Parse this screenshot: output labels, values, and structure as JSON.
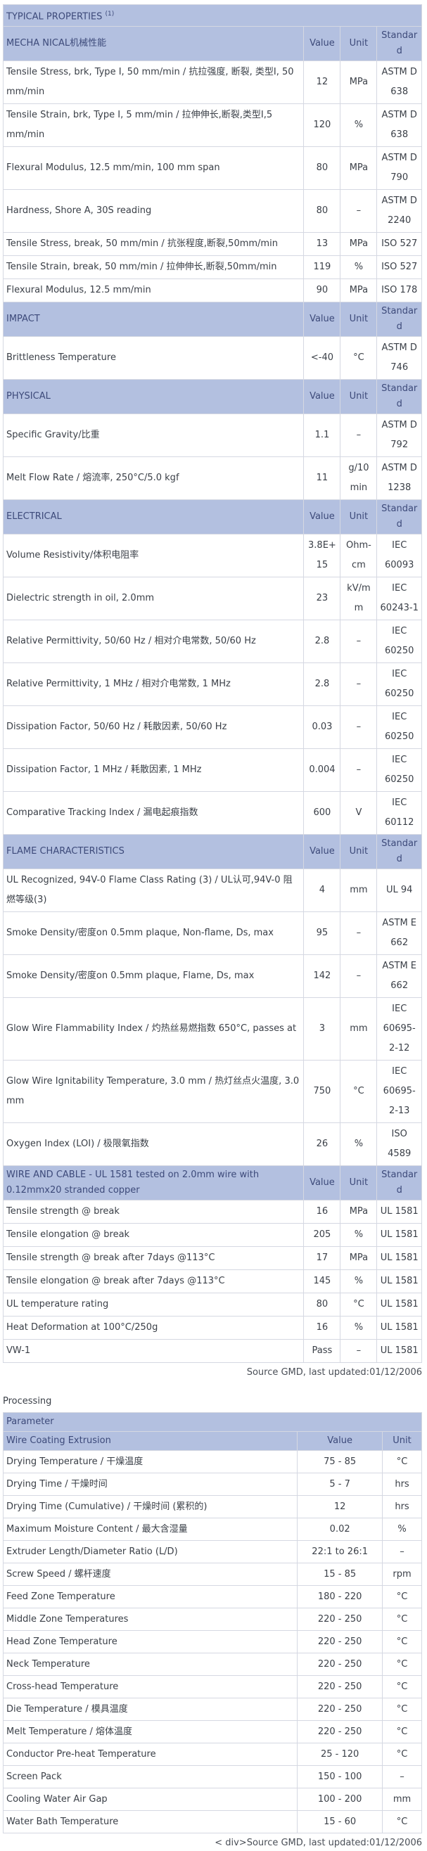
{
  "properties": {
    "sections": [
      {
        "title": "TYPICAL PROPERTIES",
        "title_note": "(1)",
        "header": {
          "label": "MECHA NICAL机械性能",
          "value": "Value",
          "unit": "Unit",
          "standard": "Standard"
        },
        "rows": [
          {
            "label": "Tensile Stress, brk, Type I, 50 mm/min / 抗拉强度, 断裂, 类型I, 50 mm/min",
            "value": "12",
            "unit": "MPa",
            "standard": "ASTM D 638"
          },
          {
            "label": "Tensile Strain, brk, Type I, 5 mm/min / 拉伸伸长,断裂,类型I,5 mm/min",
            "value": "120",
            "unit": "%",
            "standard": "ASTM D 638"
          },
          {
            "label": "Flexural Modulus, 12.5 mm/min, 100 mm span",
            "value": "80",
            "unit": "MPa",
            "standard": "ASTM D 790"
          },
          {
            "label": "Hardness, Shore A, 30S reading",
            "value": "80",
            "unit": "–",
            "standard": "ASTM D 2240"
          },
          {
            "label": "Tensile Stress, break, 50 mm/min / 抗张程度,断裂,50mm/min",
            "value": "13",
            "unit": "MPa",
            "standard": "ISO 527"
          },
          {
            "label": "Tensile Strain, break, 50 mm/min / 拉伸伸长,断裂,50mm/min",
            "value": "119",
            "unit": "%",
            "standard": "ISO 527"
          },
          {
            "label": "Flexural Modulus, 12.5 mm/min",
            "value": "90",
            "unit": "MPa",
            "standard": "ISO 178"
          }
        ]
      },
      {
        "header": {
          "label": "IMPACT",
          "value": "Value",
          "unit": "Unit",
          "standard": "Standard"
        },
        "rows": [
          {
            "label": "Brittleness Temperature",
            "value": "<-40",
            "unit": "°C",
            "standard": "ASTM D 746"
          }
        ]
      },
      {
        "header": {
          "label": "PHYSICAL",
          "value": "Value",
          "unit": "Unit",
          "standard": "Standard"
        },
        "rows": [
          {
            "label": "Specific Gravity/比重",
            "value": "1.1",
            "unit": "–",
            "standard": "ASTM D 792"
          },
          {
            "label": "Melt Flow Rate / 熔流率, 250°C/5.0 kgf",
            "value": "11",
            "unit": "g/10 min",
            "standard": "ASTM D 1238"
          }
        ]
      },
      {
        "header": {
          "label": "ELECTRICAL",
          "value": "Value",
          "unit": "Unit",
          "standard": "Standard"
        },
        "rows": [
          {
            "label": "Volume Resistivity/体积电阻率",
            "value": "3.8E+15",
            "unit": "Ohm-cm",
            "standard": "IEC 60093"
          },
          {
            "label": "Dielectric strength in oil, 2.0mm",
            "value": "23",
            "unit": "kV/mm",
            "standard": "IEC 60243-1"
          },
          {
            "label": "Relative Permittivity, 50/60 Hz / 相对介电常数, 50/60 Hz",
            "value": "2.8",
            "unit": "–",
            "standard": "IEC 60250"
          },
          {
            "label": "Relative Permittivity, 1 MHz / 相对介电常数, 1 MHz",
            "value": "2.8",
            "unit": "–",
            "standard": "IEC 60250"
          },
          {
            "label": "Dissipation Factor, 50/60 Hz / 耗散因素, 50/60 Hz",
            "value": "0.03",
            "unit": "–",
            "standard": "IEC 60250"
          },
          {
            "label": "Dissipation Factor, 1 MHz / 耗散因素, 1 MHz",
            "value": "0.004",
            "unit": "–",
            "standard": "IEC 60250"
          },
          {
            "label": "Comparative Tracking Index / 漏电起痕指数",
            "value": "600",
            "unit": "V",
            "standard": "IEC 60112"
          }
        ]
      },
      {
        "header": {
          "label": "FLAME CHARACTERISTICS",
          "value": "Value",
          "unit": "Unit",
          "standard": "Standard"
        },
        "rows": [
          {
            "label": "UL Recognized, 94V-0 Flame Class Rating (3) / UL认可,94V-0 阻燃等级(3)",
            "value": "4",
            "unit": "mm",
            "standard": "UL 94"
          },
          {
            "label": "Smoke Density/密度on 0.5mm plaque, Non-flame, Ds, max",
            "value": "95",
            "unit": "–",
            "standard": "ASTM E 662"
          },
          {
            "label": "Smoke Density/密度on 0.5mm plaque, Flame, Ds, max",
            "value": "142",
            "unit": "–",
            "standard": "ASTM E 662"
          },
          {
            "label": "Glow Wire Flammability Index / 灼热丝易燃指数 650°C, passes at",
            "value": "3",
            "unit": "mm",
            "standard": "IEC 60695-2-12"
          },
          {
            "label": "Glow Wire Ignitability Temperature, 3.0 mm / 热灯丝点火温度, 3.0 mm",
            "value": "750",
            "unit": "°C",
            "standard": "IEC 60695-2-13"
          },
          {
            "label": "Oxygen Index (LOI) / 极限氧指数",
            "value": "26",
            "unit": "%",
            "standard": "ISO 4589"
          }
        ]
      },
      {
        "header": {
          "label": "WIRE AND CABLE - UL 1581 tested on 2.0mm wire with 0.12mmx20 stranded copper",
          "value": "Value",
          "unit": "Unit",
          "standard": "Standard"
        },
        "rows": [
          {
            "label": "Tensile strength @ break",
            "value": "16",
            "unit": "MPa",
            "standard": "UL 1581"
          },
          {
            "label": "Tensile elongation @ break",
            "value": "205",
            "unit": "%",
            "standard": "UL 1581"
          },
          {
            "label": "Tensile strength @ break after 7days @113°C",
            "value": "17",
            "unit": "MPa",
            "standard": "UL 1581"
          },
          {
            "label": "Tensile elongation @ break after 7days @113°C",
            "value": "145",
            "unit": "%",
            "standard": "UL 1581"
          },
          {
            "label": "UL temperature rating",
            "value": "80",
            "unit": "°C",
            "standard": "UL 1581"
          },
          {
            "label": "Heat Deformation at 100°C/250g",
            "value": "16",
            "unit": "%",
            "standard": "UL 1581"
          },
          {
            "label": "VW-1",
            "value": "Pass",
            "unit": "–",
            "standard": "UL 1581"
          }
        ]
      }
    ],
    "source": "Source GMD, last updated:01/12/2006"
  },
  "processing": {
    "title": "Processing",
    "param_header": "Parameter",
    "header": {
      "label": "Wire Coating Extrusion",
      "value": "Value",
      "unit": "Unit"
    },
    "rows": [
      {
        "label": "Drying Temperature / 干燥温度",
        "value": "75 - 85",
        "unit": "°C"
      },
      {
        "label": "Drying Time / 干燥时间",
        "value": "5 - 7",
        "unit": "hrs"
      },
      {
        "label": "Drying Time (Cumulative) / 干燥时间 (累积的)",
        "value": "12",
        "unit": "hrs"
      },
      {
        "label": "Maximum Moisture Content / 最大含湿量",
        "value": "0.02",
        "unit": "%"
      },
      {
        "label": "Extruder Length/Diameter Ratio (L/D)",
        "value": "22:1 to 26:1",
        "unit": "–"
      },
      {
        "label": "Screw Speed / 螺杆速度",
        "value": "15 - 85",
        "unit": "rpm"
      },
      {
        "label": "Feed Zone Temperature",
        "value": "180 - 220",
        "unit": "°C"
      },
      {
        "label": "Middle Zone Temperatures",
        "value": "220 - 250",
        "unit": "°C"
      },
      {
        "label": "Head Zone Temperature",
        "value": "220 - 250",
        "unit": "°C"
      },
      {
        "label": "Neck Temperature",
        "value": "220 - 250",
        "unit": "°C"
      },
      {
        "label": "Cross-head Temperature",
        "value": "220 - 250",
        "unit": "°C"
      },
      {
        "label": "Die Temperature / 模具温度",
        "value": "220 - 250",
        "unit": "°C"
      },
      {
        "label": "Melt Temperature / 熔体温度",
        "value": "220 - 250",
        "unit": "°C"
      },
      {
        "label": "Conductor Pre-heat Temperature",
        "value": "25 - 120",
        "unit": "°C"
      },
      {
        "label": "Screen Pack",
        "value": "150 - 100",
        "unit": "–"
      },
      {
        "label": "Cooling Water Air Gap",
        "value": "100 - 200",
        "unit": "mm"
      },
      {
        "label": "Water Bath Temperature",
        "value": "15 - 60",
        "unit": "°C"
      }
    ],
    "footer": "< div>Source GMD, last updated:01/12/2006"
  }
}
